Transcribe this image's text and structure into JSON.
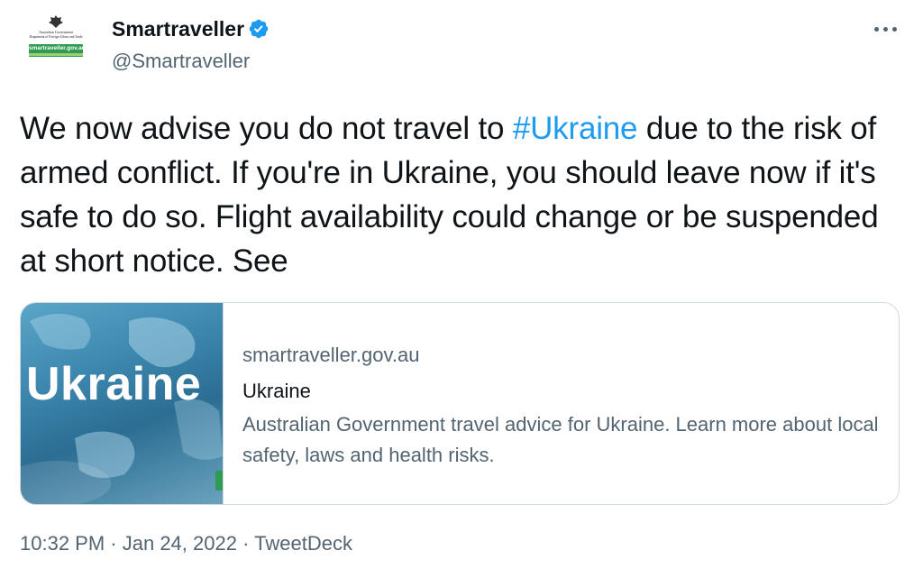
{
  "author": {
    "display_name": "Smartraveller",
    "handle": "@Smartraveller",
    "verified": true,
    "avatar": {
      "gov_line_1": "Australian Government",
      "gov_line_2": "Department of Foreign Affairs and Trade",
      "url_text": "smartraveller.gov.au"
    }
  },
  "tweet": {
    "text_before": "We now advise you do not travel to ",
    "hashtag": "#Ukraine",
    "text_after": " due to the risk of armed conflict. If you're in Ukraine, you should leave now if it's safe to do so. Flight availability could change or be suspended at short notice. See"
  },
  "card": {
    "image_title": "Ukraine",
    "domain": "smartraveller.gov.au",
    "title": "Ukraine",
    "description": "Australian Government travel advice for Ukraine. Learn more about local safety, laws and health risks."
  },
  "meta": {
    "time": "10:32 PM",
    "separator": " · ",
    "date": "Jan 24, 2022",
    "source": "TweetDeck"
  },
  "icons": {
    "verified": "verified-badge-icon",
    "more": "more-options-icon"
  },
  "colors": {
    "link_blue": "#1d9bf0",
    "text_primary": "#0f1419",
    "text_secondary": "#536471",
    "card_border": "#cfd9de",
    "brand_green": "#2f9a52"
  }
}
